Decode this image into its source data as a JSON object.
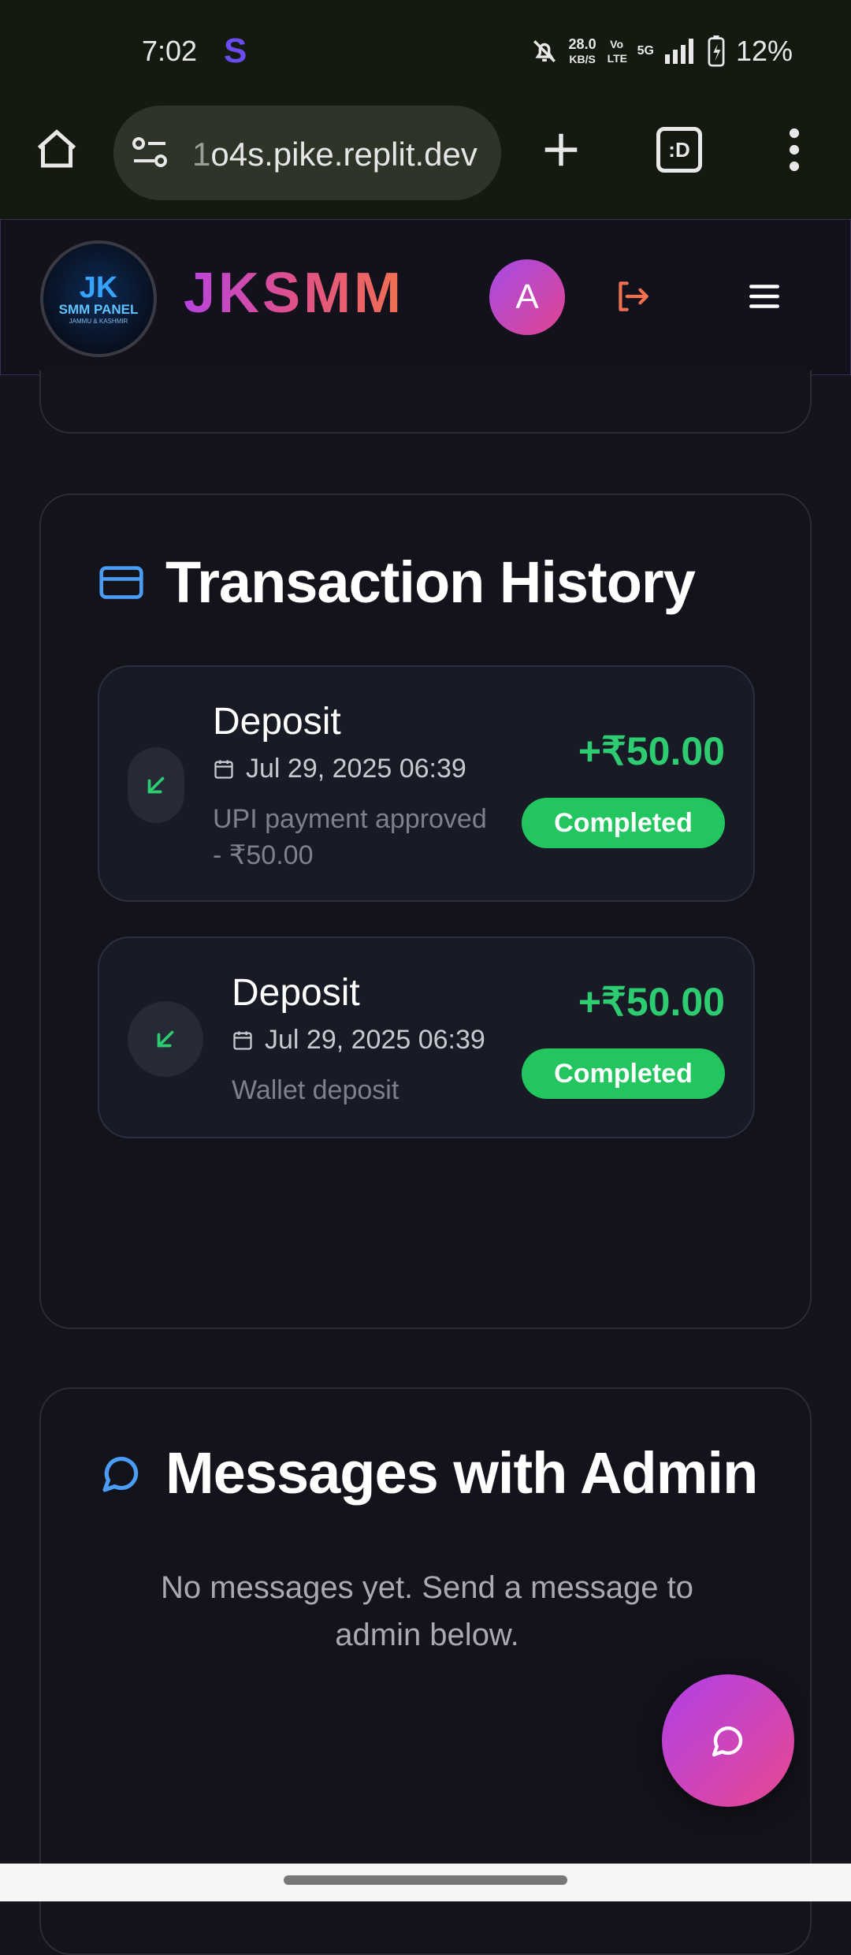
{
  "status_bar": {
    "time": "7:02",
    "app_icon": "S",
    "net_speed": "28.0",
    "net_unit": "KB/S",
    "volte": "Vo LTE",
    "network": "5G",
    "battery": "12%"
  },
  "browser": {
    "url_prefix": "1",
    "url": "o4s.pike.replit.dev",
    "tab_label": ":D"
  },
  "header": {
    "logo_text_1": "JK",
    "logo_text_2": "SMM PANEL",
    "logo_text_3": "JAMMU & KASHMIR",
    "brand": "JKSMM",
    "avatar_initial": "A"
  },
  "transactions": {
    "title": "Transaction History",
    "items": [
      {
        "title": "Deposit",
        "date": "Jul 29, 2025 06:39",
        "note_line1": "UPI payment approved",
        "note_line2": "- ₹50.00",
        "amount": "+₹50.00",
        "status": "Completed"
      },
      {
        "title": "Deposit",
        "date": "Jul 29, 2025 06:39",
        "note_line1": "Wallet deposit",
        "amount": "+₹50.00",
        "status": "Completed"
      }
    ]
  },
  "messages": {
    "title": "Messages with Admin",
    "empty_text": "No messages yet. Send a message to admin below."
  },
  "colors": {
    "accent_purple": "#a64be8",
    "accent_pink": "#e0458e",
    "success": "#22c55e",
    "amount_green": "#2ecc71"
  }
}
